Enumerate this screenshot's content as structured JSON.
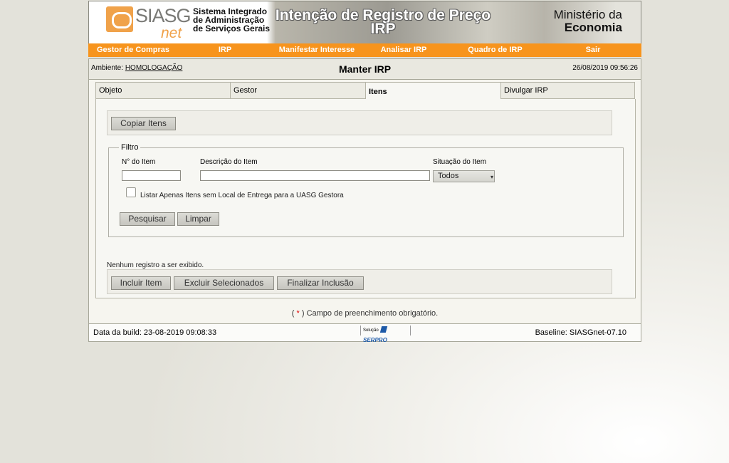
{
  "header": {
    "logo_text": "SIASG",
    "logo_net": "net",
    "system_title": "Sistema Integrado de Administração de Serviços Gerais",
    "banner_title": "Intenção de Registro de Preço IRP",
    "ministry_line1": "Ministério da",
    "ministry_line2": "Economia",
    "brand_color": "#f7941d"
  },
  "menu": [
    {
      "label": "Gestor de Compras"
    },
    {
      "label": "IRP"
    },
    {
      "label": "Manifestar Interesse"
    },
    {
      "label": "Analisar IRP"
    },
    {
      "label": "Quadro de IRP"
    },
    {
      "label": "Sair"
    }
  ],
  "ambient": {
    "label": "Ambiente:",
    "value": "HOMOLOGAÇÃO",
    "page_title": "Manter IRP",
    "datetime": "26/08/2019 09:56:26"
  },
  "tabs": [
    {
      "label": "Objeto"
    },
    {
      "label": "Gestor"
    },
    {
      "label": "Itens",
      "active": true
    },
    {
      "label": "Divulgar IRP"
    }
  ],
  "buttons": {
    "copy_items": "Copiar Itens",
    "search": "Pesquisar",
    "clear": "Limpar",
    "include_item": "Incluir Item",
    "delete_selected": "Excluir Selecionados",
    "finish_inclusion": "Finalizar Inclusão"
  },
  "filter": {
    "legend": "Filtro",
    "item_number_label": "N° do Item",
    "item_number_value": "",
    "description_label": "Descrição do Item",
    "description_value": "",
    "status_label": "Situação do Item",
    "status_selected": "Todos",
    "checkbox_label": "Listar Apenas Itens sem Local de Entrega para a UASG Gestora",
    "checkbox_checked": false
  },
  "results": {
    "empty_message": "Nenhum registro a ser exibido."
  },
  "required_note": {
    "open": "(",
    "star": "*",
    "text": ") Campo de preenchimento obrigatório."
  },
  "footer": {
    "build_date": "Data da build: 23-08-2019 09:08:33",
    "solution_label": "Solução",
    "solution_brand": "SERPRO",
    "baseline": "Baseline: SIASGnet-07.10"
  }
}
